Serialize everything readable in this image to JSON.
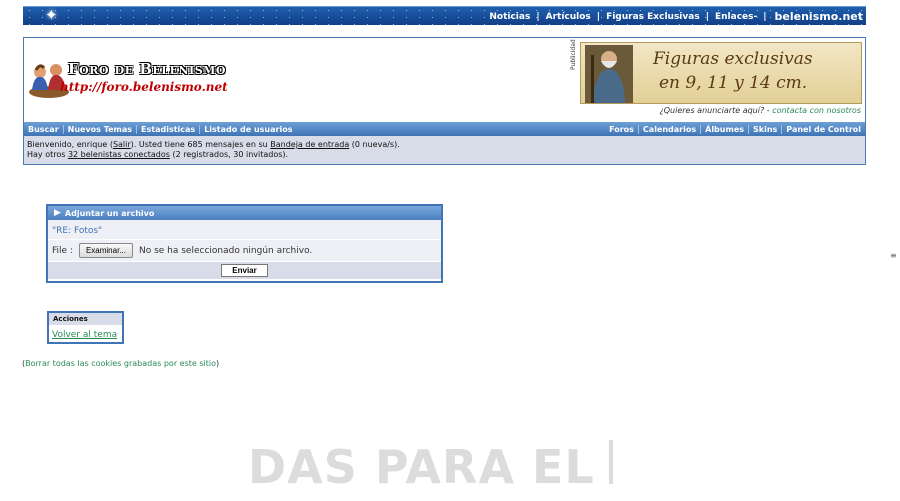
{
  "topbar": {
    "links": [
      "Noticias",
      "Artículos",
      "Figuras Exclusivas",
      "Enlaces-"
    ],
    "brand": "belenismo.net"
  },
  "header": {
    "logo_title": "Foro de Belenismo",
    "logo_url": "http://foro.belenismo.net",
    "ad_label": "Publicidad",
    "banner_line1": "Figuras exclusivas",
    "banner_line2": "en 9, 11 y 14 cm.",
    "ad_question": "¿Quieres anunciarte aquí? - ",
    "ad_contact": "contacta con nosotros"
  },
  "navbar": {
    "left": [
      "Buscar",
      "Nuevos Temas",
      "Estadisticas",
      "Listado de usuarios"
    ],
    "right": [
      "Foros",
      "Calendarios",
      "Álbumes",
      "Skins",
      "Panel de Control"
    ]
  },
  "welcome": {
    "line1_a": "Bienvenido, enrique (",
    "logout": "Salir",
    "line1_b": "). Usted tiene 685 mensajes en su ",
    "inbox": "Bandeja de entrada",
    "line1_c": " (0 nueva/s).",
    "line2_a": "Hay otros ",
    "online": "32 belenistas conectados",
    "line2_b": " (2 registrados, 30 invitados)."
  },
  "attach": {
    "title": "Adjuntar un archivo",
    "subject": "\"RE: Fotos\"",
    "file_label": "File :",
    "browse_button": "Examinar...",
    "no_file": "No se ha seleccionado ningún archivo.",
    "send_button": "Enviar"
  },
  "actions": {
    "title": "Acciones",
    "back_link": "Volver al tema"
  },
  "cookies": {
    "open": "(",
    "text": "Borrar todas las cookies grabadas por este sitio",
    "close": ")"
  },
  "bottom": {
    "bigtext": "DAS PARA EL"
  },
  "scroll_marker": "≡"
}
